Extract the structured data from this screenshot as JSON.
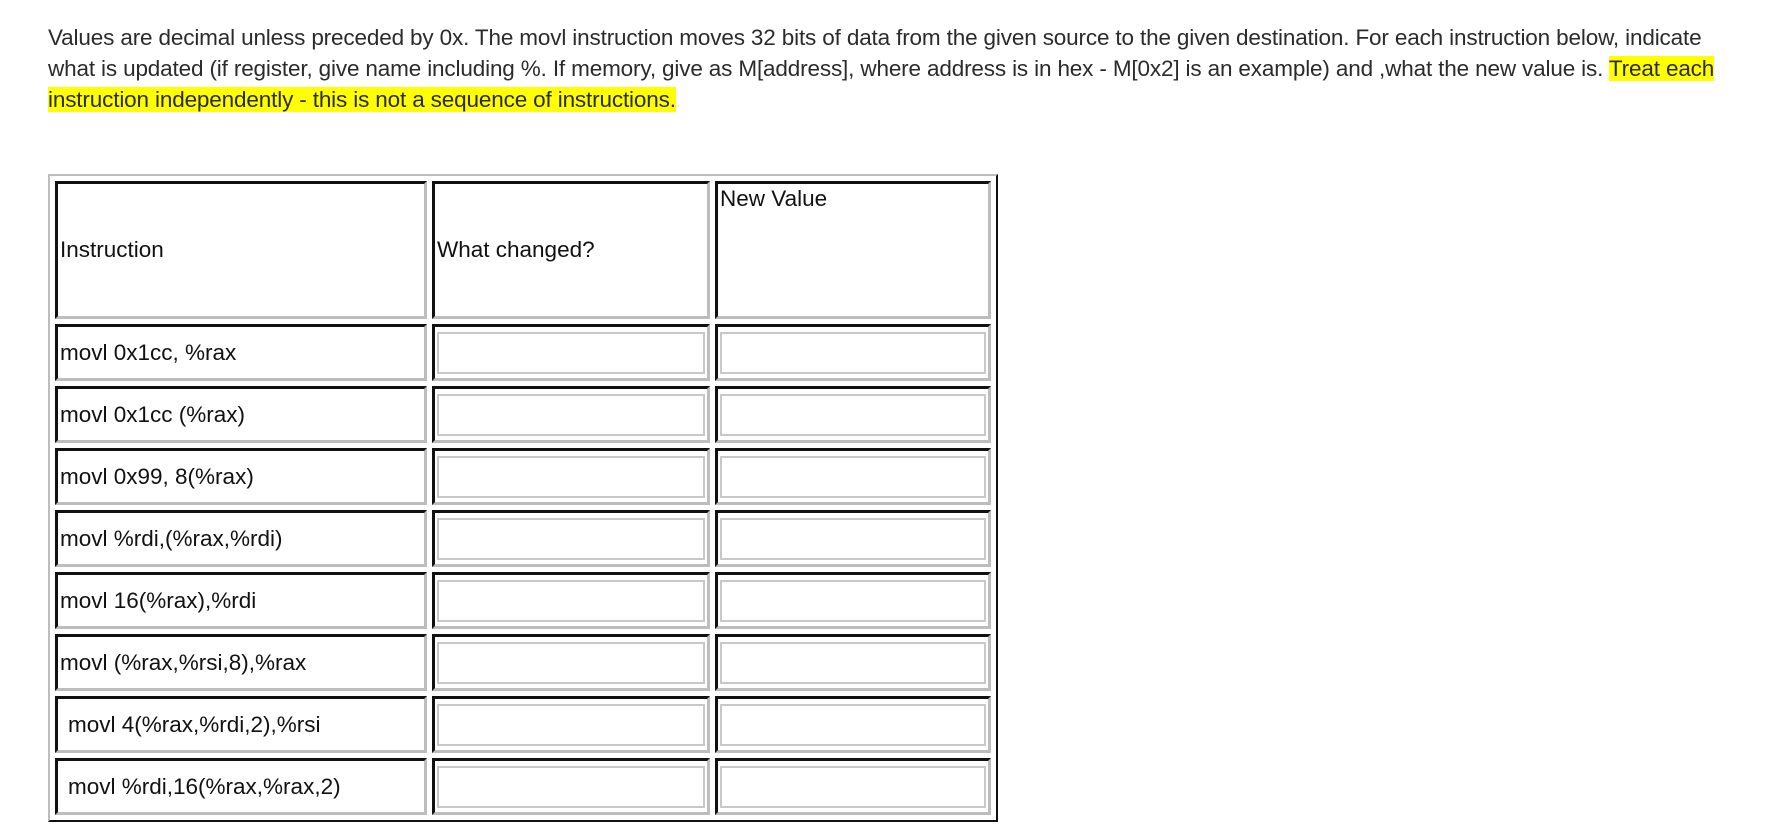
{
  "instructions": {
    "text_main": "Values are decimal unless preceded by 0x. The movl instruction moves 32 bits of data from the given source to the given destination.  For each instruction below, indicate what is updated (if register, give name including %.   If memory, give as M[address], where address is in hex - M[0x2] is an example) and ,what the new value is.  ",
    "text_highlight": "Treat each instruction independently - this is not a sequence of instructions.",
    "highlight_color": "#ffff00"
  },
  "table": {
    "headers": {
      "instruction": "Instruction",
      "what_changed": "What changed?",
      "new_value": "New Value"
    },
    "rows": [
      {
        "instruction": "movl 0x1cc, %rax",
        "what_changed": "",
        "new_value": ""
      },
      {
        "instruction": "movl 0x1cc (%rax)",
        "what_changed": "",
        "new_value": ""
      },
      {
        "instruction": "movl 0x99, 8(%rax)",
        "what_changed": "",
        "new_value": ""
      },
      {
        "instruction": "movl %rdi,(%rax,%rdi)",
        "what_changed": "",
        "new_value": ""
      },
      {
        "instruction": "movl 16(%rax),%rdi",
        "what_changed": "",
        "new_value": ""
      },
      {
        "instruction": "movl (%rax,%rsi,8),%rax",
        "what_changed": "",
        "new_value": ""
      },
      {
        "instruction": "movl 4(%rax,%rdi,2),%rsi",
        "what_changed": "",
        "new_value": ""
      },
      {
        "instruction": "movl %rdi,16(%rax,%rax,2)",
        "what_changed": "",
        "new_value": ""
      }
    ]
  }
}
